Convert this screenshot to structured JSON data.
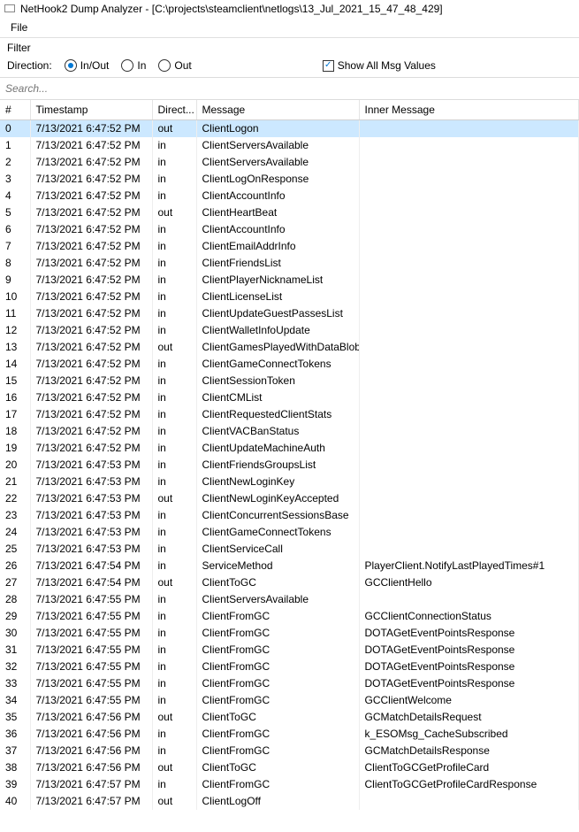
{
  "window": {
    "title": "NetHook2 Dump Analyzer - [C:\\projects\\steamclient\\netlogs\\13_Jul_2021_15_47_48_429]"
  },
  "menubar": {
    "file": "File"
  },
  "filter": {
    "title": "Filter",
    "direction_label": "Direction:",
    "options": {
      "inout": "In/Out",
      "in": "In",
      "out": "Out"
    },
    "selected": "inout",
    "show_all_label": "Show All Msg Values",
    "show_all_checked": true
  },
  "search": {
    "placeholder": "Search..."
  },
  "table": {
    "headers": {
      "num": "#",
      "timestamp": "Timestamp",
      "direction": "Direct...",
      "message": "Message",
      "inner": "Inner Message"
    },
    "rows": [
      {
        "n": "0",
        "ts": "7/13/2021 6:47:52 PM",
        "dir": "out",
        "msg": "ClientLogon",
        "inner": "",
        "sel": true
      },
      {
        "n": "1",
        "ts": "7/13/2021 6:47:52 PM",
        "dir": "in",
        "msg": "ClientServersAvailable",
        "inner": ""
      },
      {
        "n": "2",
        "ts": "7/13/2021 6:47:52 PM",
        "dir": "in",
        "msg": "ClientServersAvailable",
        "inner": ""
      },
      {
        "n": "3",
        "ts": "7/13/2021 6:47:52 PM",
        "dir": "in",
        "msg": "ClientLogOnResponse",
        "inner": ""
      },
      {
        "n": "4",
        "ts": "7/13/2021 6:47:52 PM",
        "dir": "in",
        "msg": "ClientAccountInfo",
        "inner": ""
      },
      {
        "n": "5",
        "ts": "7/13/2021 6:47:52 PM",
        "dir": "out",
        "msg": "ClientHeartBeat",
        "inner": ""
      },
      {
        "n": "6",
        "ts": "7/13/2021 6:47:52 PM",
        "dir": "in",
        "msg": "ClientAccountInfo",
        "inner": ""
      },
      {
        "n": "7",
        "ts": "7/13/2021 6:47:52 PM",
        "dir": "in",
        "msg": "ClientEmailAddrInfo",
        "inner": ""
      },
      {
        "n": "8",
        "ts": "7/13/2021 6:47:52 PM",
        "dir": "in",
        "msg": "ClientFriendsList",
        "inner": ""
      },
      {
        "n": "9",
        "ts": "7/13/2021 6:47:52 PM",
        "dir": "in",
        "msg": "ClientPlayerNicknameList",
        "inner": ""
      },
      {
        "n": "10",
        "ts": "7/13/2021 6:47:52 PM",
        "dir": "in",
        "msg": "ClientLicenseList",
        "inner": ""
      },
      {
        "n": "11",
        "ts": "7/13/2021 6:47:52 PM",
        "dir": "in",
        "msg": "ClientUpdateGuestPassesList",
        "inner": ""
      },
      {
        "n": "12",
        "ts": "7/13/2021 6:47:52 PM",
        "dir": "in",
        "msg": "ClientWalletInfoUpdate",
        "inner": ""
      },
      {
        "n": "13",
        "ts": "7/13/2021 6:47:52 PM",
        "dir": "out",
        "msg": "ClientGamesPlayedWithDataBlob",
        "inner": ""
      },
      {
        "n": "14",
        "ts": "7/13/2021 6:47:52 PM",
        "dir": "in",
        "msg": "ClientGameConnectTokens",
        "inner": ""
      },
      {
        "n": "15",
        "ts": "7/13/2021 6:47:52 PM",
        "dir": "in",
        "msg": "ClientSessionToken",
        "inner": ""
      },
      {
        "n": "16",
        "ts": "7/13/2021 6:47:52 PM",
        "dir": "in",
        "msg": "ClientCMList",
        "inner": ""
      },
      {
        "n": "17",
        "ts": "7/13/2021 6:47:52 PM",
        "dir": "in",
        "msg": "ClientRequestedClientStats",
        "inner": ""
      },
      {
        "n": "18",
        "ts": "7/13/2021 6:47:52 PM",
        "dir": "in",
        "msg": "ClientVACBanStatus",
        "inner": ""
      },
      {
        "n": "19",
        "ts": "7/13/2021 6:47:52 PM",
        "dir": "in",
        "msg": "ClientUpdateMachineAuth",
        "inner": ""
      },
      {
        "n": "20",
        "ts": "7/13/2021 6:47:53 PM",
        "dir": "in",
        "msg": "ClientFriendsGroupsList",
        "inner": ""
      },
      {
        "n": "21",
        "ts": "7/13/2021 6:47:53 PM",
        "dir": "in",
        "msg": "ClientNewLoginKey",
        "inner": ""
      },
      {
        "n": "22",
        "ts": "7/13/2021 6:47:53 PM",
        "dir": "out",
        "msg": "ClientNewLoginKeyAccepted",
        "inner": ""
      },
      {
        "n": "23",
        "ts": "7/13/2021 6:47:53 PM",
        "dir": "in",
        "msg": "ClientConcurrentSessionsBase",
        "inner": ""
      },
      {
        "n": "24",
        "ts": "7/13/2021 6:47:53 PM",
        "dir": "in",
        "msg": "ClientGameConnectTokens",
        "inner": ""
      },
      {
        "n": "25",
        "ts": "7/13/2021 6:47:53 PM",
        "dir": "in",
        "msg": "ClientServiceCall",
        "inner": ""
      },
      {
        "n": "26",
        "ts": "7/13/2021 6:47:54 PM",
        "dir": "in",
        "msg": "ServiceMethod",
        "inner": "PlayerClient.NotifyLastPlayedTimes#1"
      },
      {
        "n": "27",
        "ts": "7/13/2021 6:47:54 PM",
        "dir": "out",
        "msg": "ClientToGC",
        "inner": "GCClientHello"
      },
      {
        "n": "28",
        "ts": "7/13/2021 6:47:55 PM",
        "dir": "in",
        "msg": "ClientServersAvailable",
        "inner": ""
      },
      {
        "n": "29",
        "ts": "7/13/2021 6:47:55 PM",
        "dir": "in",
        "msg": "ClientFromGC",
        "inner": "GCClientConnectionStatus"
      },
      {
        "n": "30",
        "ts": "7/13/2021 6:47:55 PM",
        "dir": "in",
        "msg": "ClientFromGC",
        "inner": "DOTAGetEventPointsResponse"
      },
      {
        "n": "31",
        "ts": "7/13/2021 6:47:55 PM",
        "dir": "in",
        "msg": "ClientFromGC",
        "inner": "DOTAGetEventPointsResponse"
      },
      {
        "n": "32",
        "ts": "7/13/2021 6:47:55 PM",
        "dir": "in",
        "msg": "ClientFromGC",
        "inner": "DOTAGetEventPointsResponse"
      },
      {
        "n": "33",
        "ts": "7/13/2021 6:47:55 PM",
        "dir": "in",
        "msg": "ClientFromGC",
        "inner": "DOTAGetEventPointsResponse"
      },
      {
        "n": "34",
        "ts": "7/13/2021 6:47:55 PM",
        "dir": "in",
        "msg": "ClientFromGC",
        "inner": "GCClientWelcome"
      },
      {
        "n": "35",
        "ts": "7/13/2021 6:47:56 PM",
        "dir": "out",
        "msg": "ClientToGC",
        "inner": "GCMatchDetailsRequest"
      },
      {
        "n": "36",
        "ts": "7/13/2021 6:47:56 PM",
        "dir": "in",
        "msg": "ClientFromGC",
        "inner": "k_ESOMsg_CacheSubscribed"
      },
      {
        "n": "37",
        "ts": "7/13/2021 6:47:56 PM",
        "dir": "in",
        "msg": "ClientFromGC",
        "inner": "GCMatchDetailsResponse"
      },
      {
        "n": "38",
        "ts": "7/13/2021 6:47:56 PM",
        "dir": "out",
        "msg": "ClientToGC",
        "inner": "ClientToGCGetProfileCard"
      },
      {
        "n": "39",
        "ts": "7/13/2021 6:47:57 PM",
        "dir": "in",
        "msg": "ClientFromGC",
        "inner": "ClientToGCGetProfileCardResponse"
      },
      {
        "n": "40",
        "ts": "7/13/2021 6:47:57 PM",
        "dir": "out",
        "msg": "ClientLogOff",
        "inner": ""
      }
    ]
  }
}
